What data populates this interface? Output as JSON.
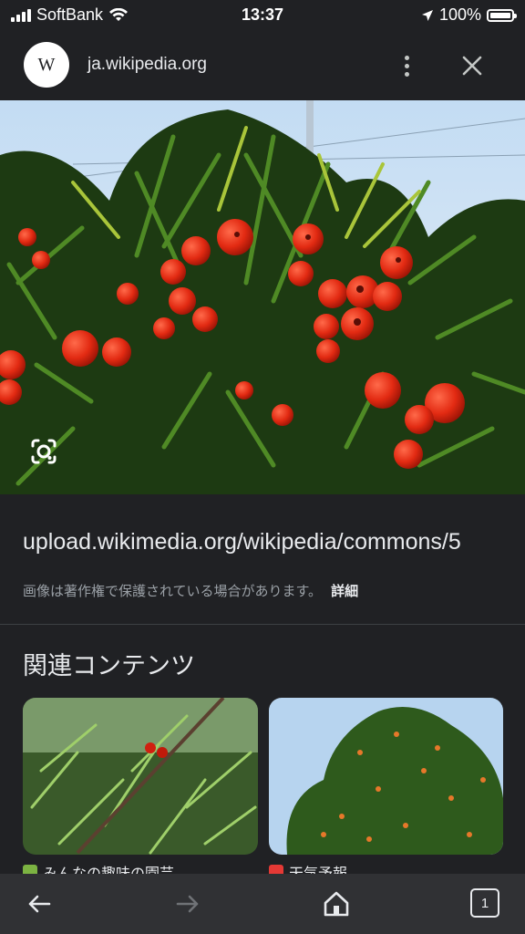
{
  "status": {
    "carrier": "SoftBank",
    "time": "13:37",
    "battery": "100%"
  },
  "topbar": {
    "favicon_letter": "W",
    "site": "ja.wikipedia.org"
  },
  "image": {
    "url": "upload.wikimedia.org/wikipedia/commons/5",
    "copyright_note": "画像は著作権で保護されている場合があります。",
    "details_link": "詳細"
  },
  "related": {
    "heading": "関連コンテンツ",
    "items": [
      {
        "source": "みんなの趣味の園芸"
      },
      {
        "source": "天気予報"
      }
    ]
  },
  "tabs": {
    "count": "1"
  }
}
